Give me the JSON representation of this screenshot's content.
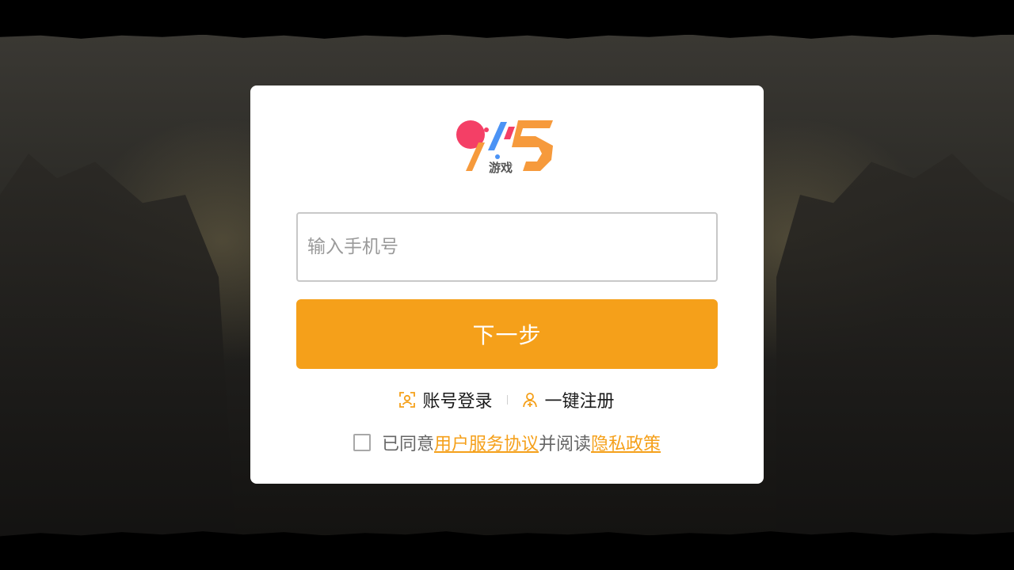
{
  "colors": {
    "accent": "#f5a01a",
    "dialog_background": "#ffffff",
    "page_background": "#000000",
    "agreement_text": "#666666"
  },
  "logo": {
    "brand_mark": "915",
    "brand_text": "游戏",
    "icon": "915-game-logo"
  },
  "login": {
    "phone_placeholder": "输入手机号",
    "phone_value": "",
    "next_label": "下一步"
  },
  "links": {
    "account_login": {
      "label": "账号登录",
      "icon": "account-scan-icon"
    },
    "one_click_register": {
      "label": "一键注册",
      "icon": "user-add-icon"
    }
  },
  "agreement": {
    "checked": false,
    "prefix": "已同意",
    "service_link": "用户服务协议",
    "middle": "并阅读",
    "privacy_link": "隐私政策"
  }
}
